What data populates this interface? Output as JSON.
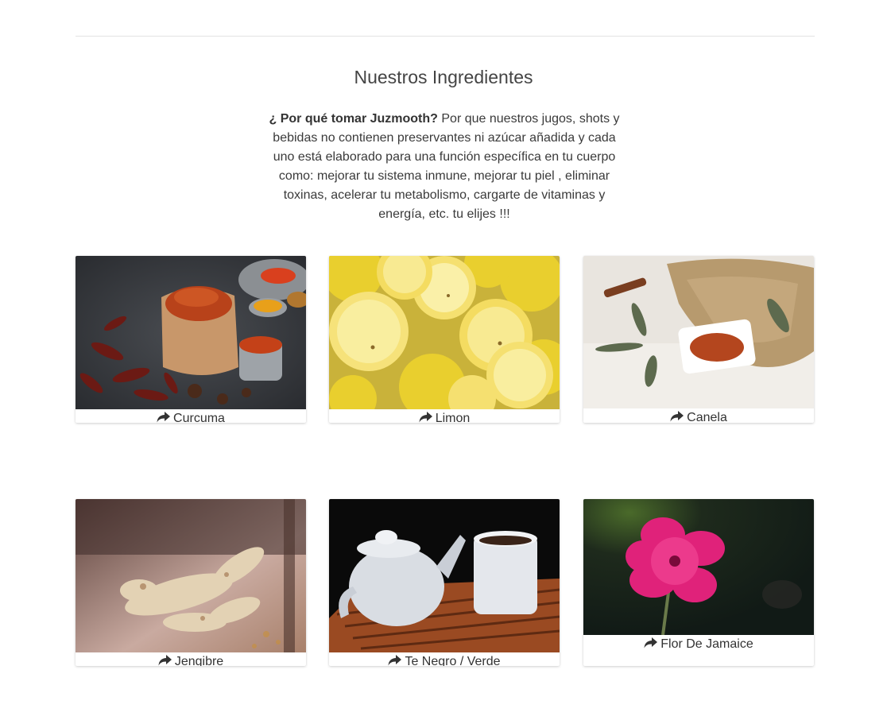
{
  "section": {
    "title": "Nuestros Ingredientes",
    "intro_bold": "¿ Por qué tomar Juzmooth?",
    "intro_text": " Por que nuestros jugos, shots y bebidas no contienen preservantes ni azúcar añadida y cada uno está elaborado para una función específica en tu cuerpo como: mejorar tu sistema inmune, mejorar tu piel , eliminar toxinas, acelerar tu metabolismo, cargarte de vitaminas y energía, etc. tu elijes !!!"
  },
  "ingredients": [
    {
      "label": "Curcuma",
      "icon": "share-icon"
    },
    {
      "label": "Limon",
      "icon": "share-icon"
    },
    {
      "label": "Canela",
      "icon": "share-icon"
    },
    {
      "label": "Jengibre",
      "icon": "share-icon"
    },
    {
      "label": "Te Negro / Verde",
      "icon": "share-icon"
    },
    {
      "label": "Flor De Jamaice",
      "icon": "share-icon"
    }
  ],
  "colors": {
    "text": "#333333",
    "divider": "#e3e3e3",
    "background": "#ffffff"
  }
}
